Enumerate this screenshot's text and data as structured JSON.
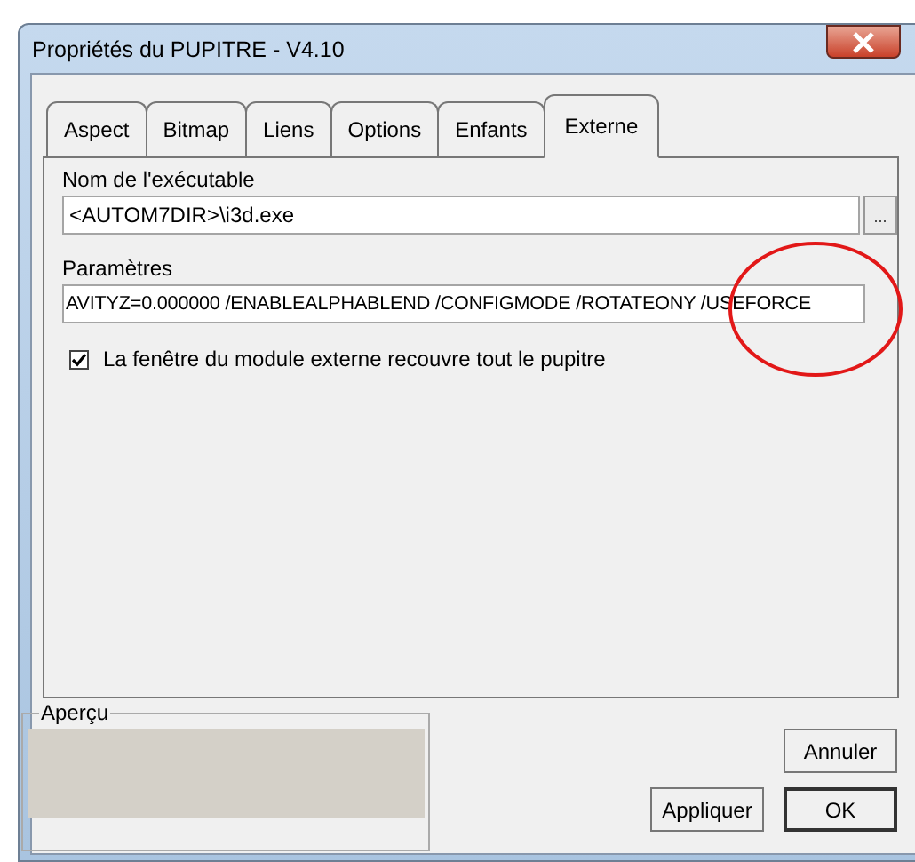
{
  "window": {
    "title": "Propriétés du PUPITRE - V4.10"
  },
  "tabs": [
    {
      "label": "Aspect",
      "selected": false
    },
    {
      "label": "Bitmap",
      "selected": false
    },
    {
      "label": "Liens",
      "selected": false
    },
    {
      "label": "Options",
      "selected": false
    },
    {
      "label": "Enfants",
      "selected": false
    },
    {
      "label": "Externe",
      "selected": true
    }
  ],
  "executable": {
    "label": "Nom de l'exécutable",
    "value": "<AUTOM7DIR>\\i3d.exe",
    "browse_button": "..."
  },
  "parameters": {
    "label": "Paramètres",
    "value": "AVITYZ=0.000000 /ENABLEALPHABLEND /CONFIGMODE /ROTATEONY /USEFORCE"
  },
  "cover_checkbox": {
    "label": "La fenêtre du module externe recouvre tout le pupitre",
    "checked": true
  },
  "preview": {
    "label": "Aperçu"
  },
  "buttons": [
    {
      "label": "Annuler",
      "kind": "cancel"
    },
    {
      "label": "Appliquer",
      "kind": "apply"
    },
    {
      "label": "OK",
      "kind": "ok"
    }
  ]
}
